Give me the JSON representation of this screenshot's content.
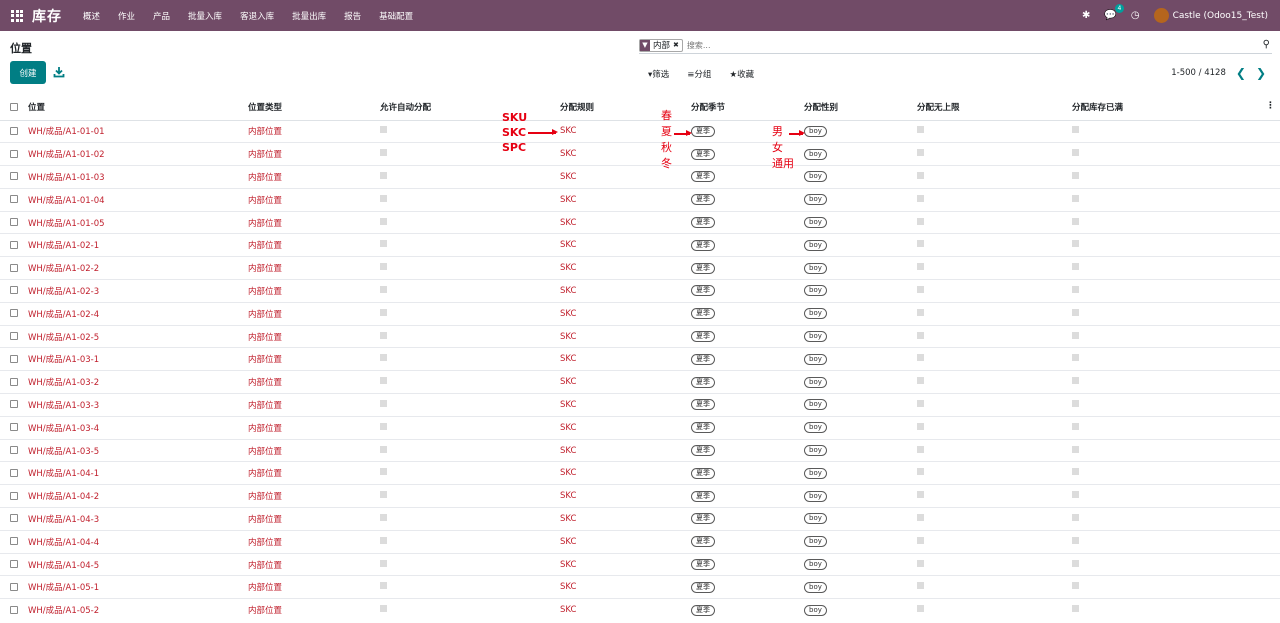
{
  "nav": {
    "brand": "库存",
    "menu": [
      "概述",
      "作业",
      "产品",
      "批量入库",
      "客退入库",
      "批量出库",
      "报告",
      "基础配置"
    ],
    "message_count": "4",
    "user": "Castle (Odoo15_Test)"
  },
  "control": {
    "title": "位置",
    "create": "创建",
    "facet_value": "内部",
    "search_placeholder": "搜索...",
    "filter": "筛选",
    "group": "分组",
    "favorite": "收藏",
    "pager": "1-500 / 4128"
  },
  "table": {
    "headers": [
      "位置",
      "位置类型",
      "允许自动分配",
      "分配规则",
      "分配季节",
      "分配性别",
      "分配无上限",
      "分配库存已满"
    ],
    "rows": [
      {
        "name": "WH/成品/A1-01-01",
        "type": "内部位置",
        "rule": "SKC",
        "season": "夏季",
        "gender": "boy"
      },
      {
        "name": "WH/成品/A1-01-02",
        "type": "内部位置",
        "rule": "SKC",
        "season": "夏季",
        "gender": "boy"
      },
      {
        "name": "WH/成品/A1-01-03",
        "type": "内部位置",
        "rule": "SKC",
        "season": "夏季",
        "gender": "boy"
      },
      {
        "name": "WH/成品/A1-01-04",
        "type": "内部位置",
        "rule": "SKC",
        "season": "夏季",
        "gender": "boy"
      },
      {
        "name": "WH/成品/A1-01-05",
        "type": "内部位置",
        "rule": "SKC",
        "season": "夏季",
        "gender": "boy"
      },
      {
        "name": "WH/成品/A1-02-1",
        "type": "内部位置",
        "rule": "SKC",
        "season": "夏季",
        "gender": "boy"
      },
      {
        "name": "WH/成品/A1-02-2",
        "type": "内部位置",
        "rule": "SKC",
        "season": "夏季",
        "gender": "boy"
      },
      {
        "name": "WH/成品/A1-02-3",
        "type": "内部位置",
        "rule": "SKC",
        "season": "夏季",
        "gender": "boy"
      },
      {
        "name": "WH/成品/A1-02-4",
        "type": "内部位置",
        "rule": "SKC",
        "season": "夏季",
        "gender": "boy"
      },
      {
        "name": "WH/成品/A1-02-5",
        "type": "内部位置",
        "rule": "SKC",
        "season": "夏季",
        "gender": "boy"
      },
      {
        "name": "WH/成品/A1-03-1",
        "type": "内部位置",
        "rule": "SKC",
        "season": "夏季",
        "gender": "boy"
      },
      {
        "name": "WH/成品/A1-03-2",
        "type": "内部位置",
        "rule": "SKC",
        "season": "夏季",
        "gender": "boy"
      },
      {
        "name": "WH/成品/A1-03-3",
        "type": "内部位置",
        "rule": "SKC",
        "season": "夏季",
        "gender": "boy"
      },
      {
        "name": "WH/成品/A1-03-4",
        "type": "内部位置",
        "rule": "SKC",
        "season": "夏季",
        "gender": "boy"
      },
      {
        "name": "WH/成品/A1-03-5",
        "type": "内部位置",
        "rule": "SKC",
        "season": "夏季",
        "gender": "boy"
      },
      {
        "name": "WH/成品/A1-04-1",
        "type": "内部位置",
        "rule": "SKC",
        "season": "夏季",
        "gender": "boy"
      },
      {
        "name": "WH/成品/A1-04-2",
        "type": "内部位置",
        "rule": "SKC",
        "season": "夏季",
        "gender": "boy"
      },
      {
        "name": "WH/成品/A1-04-3",
        "type": "内部位置",
        "rule": "SKC",
        "season": "夏季",
        "gender": "boy"
      },
      {
        "name": "WH/成品/A1-04-4",
        "type": "内部位置",
        "rule": "SKC",
        "season": "夏季",
        "gender": "boy"
      },
      {
        "name": "WH/成品/A1-04-5",
        "type": "内部位置",
        "rule": "SKC",
        "season": "夏季",
        "gender": "boy"
      },
      {
        "name": "WH/成品/A1-05-1",
        "type": "内部位置",
        "rule": "SKC",
        "season": "夏季",
        "gender": "boy"
      },
      {
        "name": "WH/成品/A1-05-2",
        "type": "内部位置",
        "rule": "SKC",
        "season": "夏季",
        "gender": "boy"
      }
    ]
  },
  "annotations": {
    "rules": [
      "SKU",
      "SKC",
      "SPC"
    ],
    "seasons": [
      "春",
      "夏",
      "秋",
      "冬"
    ],
    "genders": [
      "男",
      "女",
      "通用"
    ]
  },
  "colors": {
    "navbar": "#714B67",
    "primary": "#017E84",
    "link": "#C01F2C",
    "annotation": "#e60012"
  }
}
